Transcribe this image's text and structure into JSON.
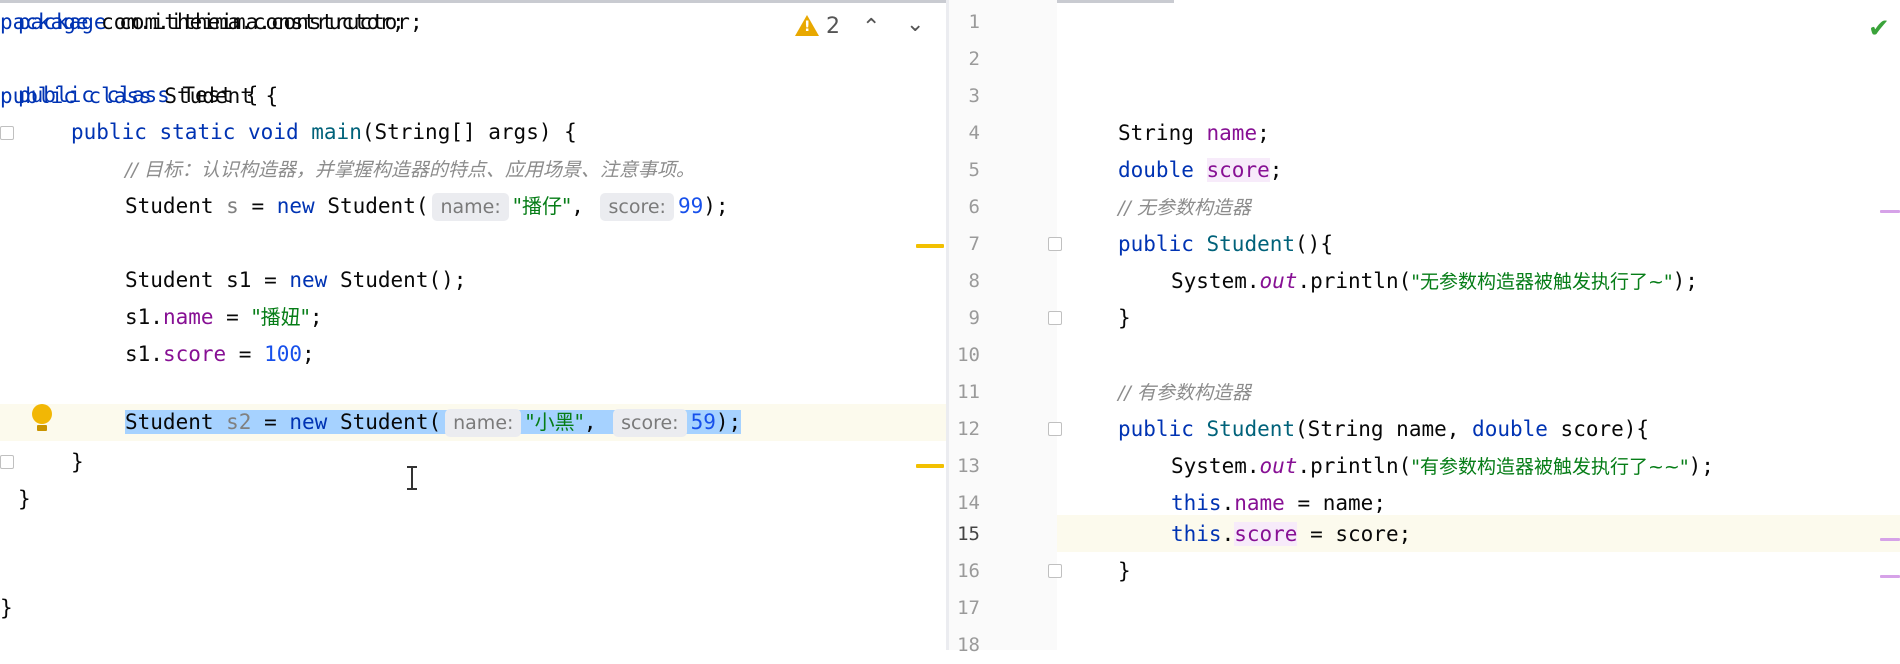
{
  "left_editor": {
    "inspection_count": "2",
    "lines": {
      "l1": {
        "a": "package",
        "b": " com.itheima.constructor;"
      },
      "l3": {
        "a": "public",
        "b": " ",
        "c": "class",
        "d": " Test {"
      },
      "l4": {
        "a": "public",
        "b": " ",
        "c": "static",
        "d": " ",
        "e": "void",
        "f": " ",
        "g": "main",
        "h": "(String[] args) {"
      },
      "l5": {
        "a": "// 目标：认识构造器，并掌握构造器的特点、应用场景、注意事项。"
      },
      "l6": {
        "a": "Student ",
        "b": "s",
        "c": " = ",
        "d": "new",
        "e": " Student(",
        "hint1": "name:",
        "f": "\"播仔\"",
        "g": ", ",
        "hint2": "score:",
        "h": "99",
        "i": ");"
      },
      "l8": {
        "a": "Student s1 = ",
        "b": "new",
        "c": " Student();"
      },
      "l9": {
        "a": "s1.",
        "b": "name",
        "c": " = ",
        "d": "\"播妞\"",
        "e": ";"
      },
      "l10": {
        "a": "s1.",
        "b": "score",
        "c": " = ",
        "d": "100",
        "e": ";"
      },
      "l12": {
        "a": "Student ",
        "b": "s2",
        "c": " = ",
        "d": "new",
        "e": " Student(",
        "hint1": "name:",
        "f": "\"小黑\"",
        "g": ", ",
        "hint2": "score:",
        "h": "59",
        "i": ");"
      },
      "l13": {
        "a": "}"
      },
      "l14": {
        "a": "}"
      }
    }
  },
  "right_editor": {
    "line_numbers": [
      "1",
      "2",
      "3",
      "4",
      "5",
      "6",
      "7",
      "8",
      "9",
      "10",
      "11",
      "12",
      "13",
      "14",
      "15",
      "16",
      "17",
      "18"
    ],
    "lines": {
      "r1": {
        "a": "package",
        "b": " com.itheima.constructor;"
      },
      "r3": {
        "a": "public",
        "b": " ",
        "c": "class",
        "d": " Student {"
      },
      "r4": {
        "a": "String ",
        "b": "name",
        "c": ";"
      },
      "r5": {
        "a": "double",
        "b": " ",
        "c": "score",
        "d": ";"
      },
      "r6": {
        "a": "// 无参数构造器"
      },
      "r7": {
        "a": "public",
        "b": " ",
        "c": "Student",
        "d": "(){"
      },
      "r8": {
        "a": "System.",
        "b": "out",
        "c": ".println(",
        "d": "\"无参数构造器被触发执行了~\"",
        "e": ");"
      },
      "r9": {
        "a": "}"
      },
      "r11": {
        "a": "// 有参数构造器"
      },
      "r12": {
        "a": "public",
        "b": " ",
        "c": "Student",
        "d": "(String name, ",
        "e": "double",
        "f": " score){"
      },
      "r13": {
        "a": "System.",
        "b": "out",
        "c": ".println(",
        "d": "\"有参数构造器被触发执行了~~\"",
        "e": ");"
      },
      "r14": {
        "a": "this",
        "b": ".",
        "c": "name",
        "d": " = name;"
      },
      "r15": {
        "a": "this",
        "b": ".",
        "c": "score",
        "d": " = score;"
      },
      "r16": {
        "a": "}"
      },
      "r17": {
        "a": "}"
      }
    }
  },
  "colors": {
    "keyword": "#0033b3",
    "field": "#871094",
    "method": "#00627a",
    "number": "#1750eb",
    "string": "#067d17",
    "comment": "#8c8c8c",
    "selection": "#a6d2ff"
  },
  "icons": {
    "warning": "warning-triangle-icon",
    "prev": "chevron-up-icon",
    "next": "chevron-down-icon",
    "intention": "lightbulb-icon",
    "ok": "checkmark-icon"
  }
}
